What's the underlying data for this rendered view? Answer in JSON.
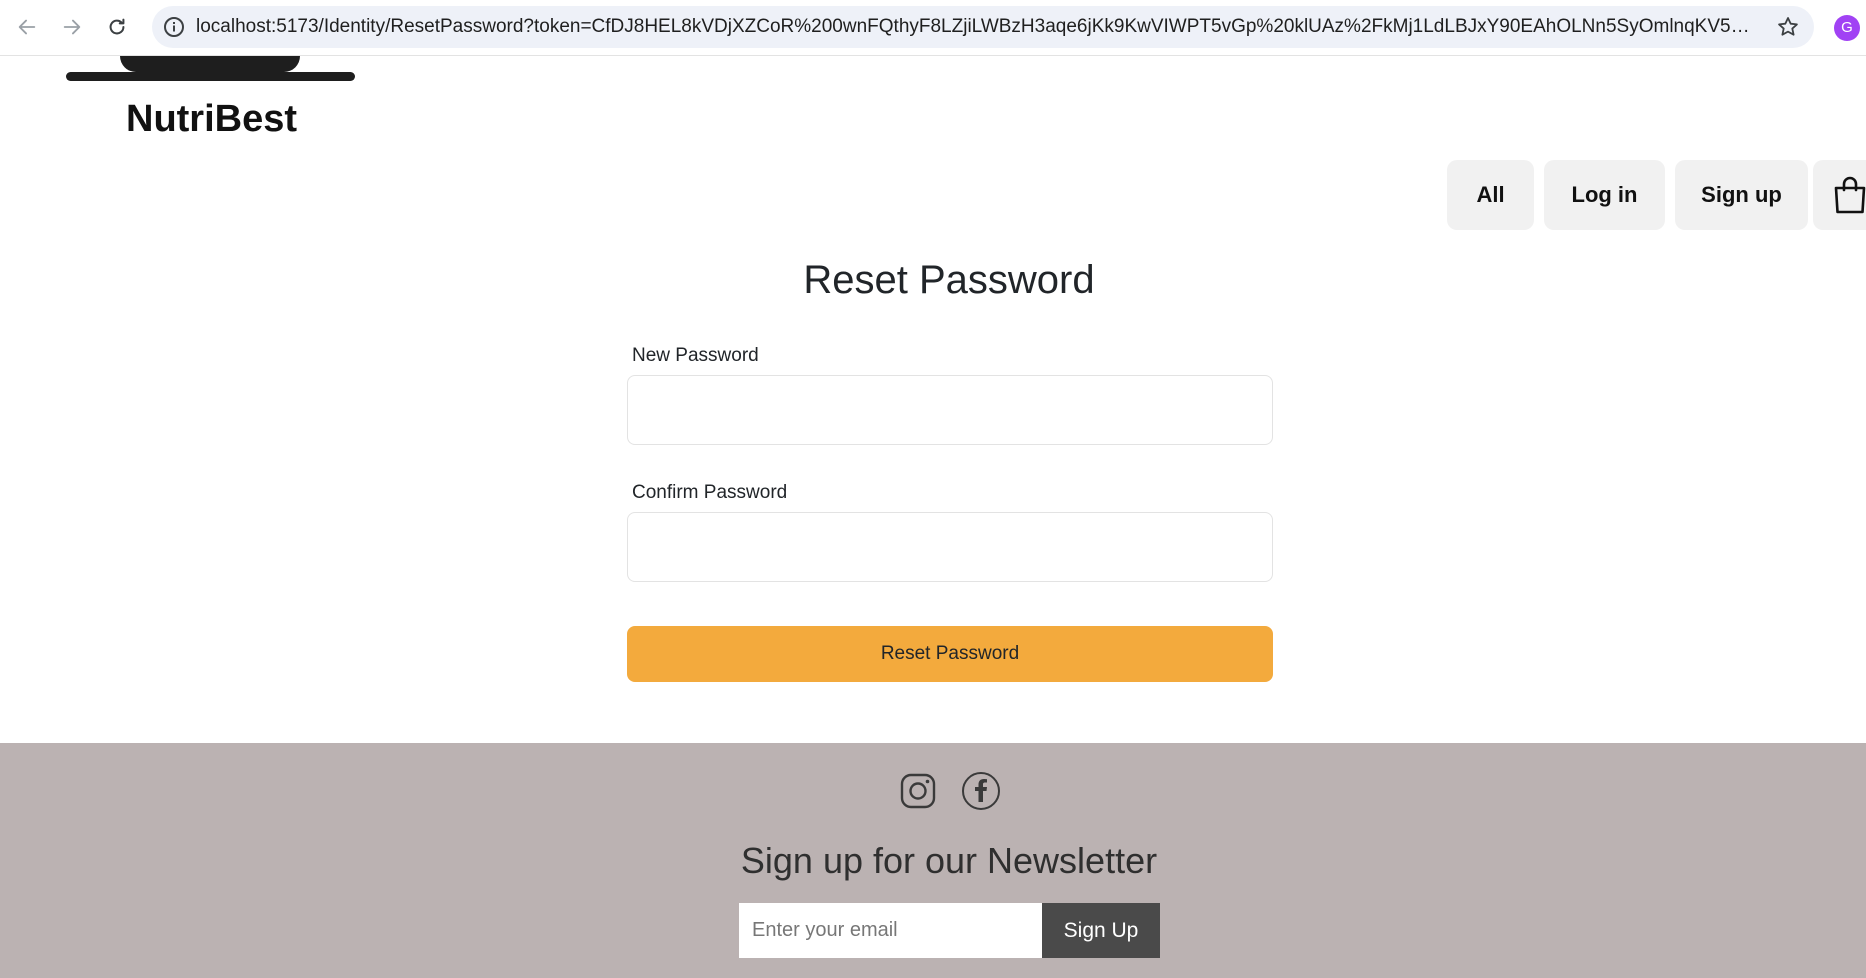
{
  "browser": {
    "url": "localhost:5173/Identity/ResetPassword?token=CfDJ8HEL8kVDjXZCoR%200wnFQthyF8LZjiLWBzH3aqe6jKk9KwVIWPT5vGp%20klUAz%2FkMj1LdLBJxY90EAhOLNn5SyOmlnqKV5uplflR6q5aqrtDakJa4kaCfFx...",
    "profile_initial": "G"
  },
  "header": {
    "brand": "NutriBest",
    "nav": {
      "all_label": "All",
      "login_label": "Log in",
      "signup_label": "Sign up"
    }
  },
  "form": {
    "title": "Reset Password",
    "new_password_label": "New Password",
    "new_password_value": "",
    "confirm_password_label": "Confirm Password",
    "confirm_password_value": "",
    "submit_label": "Reset Password",
    "submit_color": "#f3aa3d"
  },
  "footer": {
    "background": "#bbb2b2",
    "social_icons": [
      "instagram-icon",
      "facebook-icon"
    ],
    "newsletter_title": "Sign up for our Newsletter",
    "email_placeholder": "Enter your email",
    "signup_button_label": "Sign Up"
  }
}
